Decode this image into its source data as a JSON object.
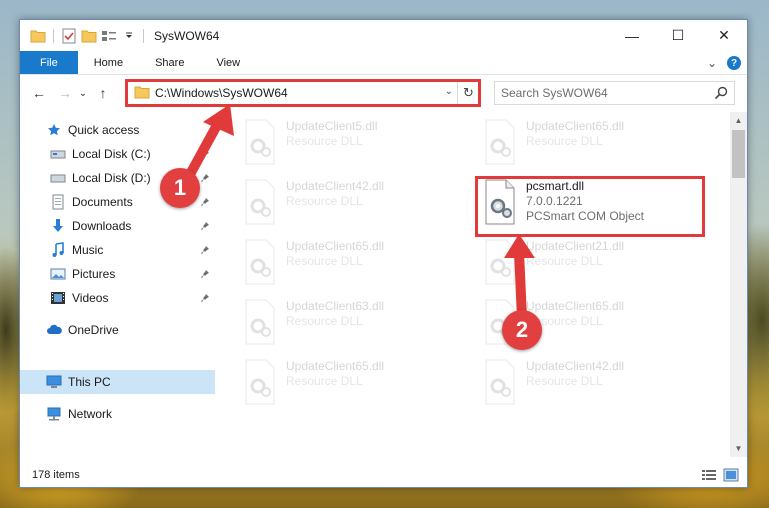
{
  "window": {
    "title": "SysWOW64",
    "controls": {
      "minimize": "—",
      "maximize": "☐",
      "close": "✕"
    }
  },
  "ribbon": {
    "tabs": [
      {
        "label": "File"
      },
      {
        "label": "Home"
      },
      {
        "label": "Share"
      },
      {
        "label": "View"
      }
    ],
    "expand_glyph": "⌄",
    "help_glyph": "?"
  },
  "address": {
    "path": "C:\\Windows\\SysWOW64",
    "dropdown_glyph": "⌄",
    "refresh_glyph": "↻"
  },
  "search": {
    "placeholder": "Search SysWOW64"
  },
  "nav_buttons": {
    "back": "←",
    "forward": "→",
    "recent": "⌄",
    "up": "↑"
  },
  "navpane": {
    "items": [
      {
        "label": "Quick access",
        "icon": "star-icon"
      },
      {
        "label": "Local Disk (C:)",
        "icon": "drive-icon",
        "pinned": true
      },
      {
        "label": "Local Disk (D:)",
        "icon": "drive-icon",
        "pinned": true
      },
      {
        "label": "Documents",
        "icon": "documents-icon",
        "pinned": true
      },
      {
        "label": "Downloads",
        "icon": "download-icon",
        "pinned": true
      },
      {
        "label": "Music",
        "icon": "music-icon",
        "pinned": true
      },
      {
        "label": "Pictures",
        "icon": "pictures-icon",
        "pinned": true
      },
      {
        "label": "Videos",
        "icon": "videos-icon",
        "pinned": true
      },
      {
        "label": "OneDrive",
        "icon": "cloud-icon"
      },
      {
        "label": "This PC",
        "icon": "computer-icon",
        "selected": true
      },
      {
        "label": "Network",
        "icon": "network-icon"
      }
    ]
  },
  "files": [
    {
      "name": "UpdateClient5.dll",
      "desc": "Resource DLL",
      "faded": true
    },
    {
      "name": "UpdateClient65.dll",
      "desc": "Resource DLL",
      "faded": true
    },
    {
      "name": "UpdateClient42.dll",
      "desc": "Resource DLL",
      "faded": true
    },
    {
      "name": "pcsmart.dll",
      "version": "7.0.0.1221",
      "desc": "PCSmart COM Object",
      "faded": false
    },
    {
      "name": "UpdateClient65.dll",
      "desc": "Resource DLL",
      "faded": true
    },
    {
      "name": "UpdateClient21.dll",
      "desc": "Resource DLL",
      "faded": true
    },
    {
      "name": "UpdateClient63.dll",
      "desc": "Resource DLL",
      "faded": true
    },
    {
      "name": "UpdateClient65.dll",
      "desc": "Resource DLL",
      "faded": true
    },
    {
      "name": "UpdateClient65.dll",
      "desc": "Resource DLL",
      "faded": true
    },
    {
      "name": "UpdateClient42.dll",
      "desc": "Resource DLL",
      "faded": true
    }
  ],
  "scrollbar": {
    "up_glyph": "▲",
    "down_glyph": "▼"
  },
  "status": {
    "item_count": "178 items"
  },
  "annotations": {
    "badge_1": "1",
    "badge_2": "2",
    "color": "#e03a3a"
  },
  "colors": {
    "accent": "#1979ca",
    "selection": "#cce4f7"
  }
}
